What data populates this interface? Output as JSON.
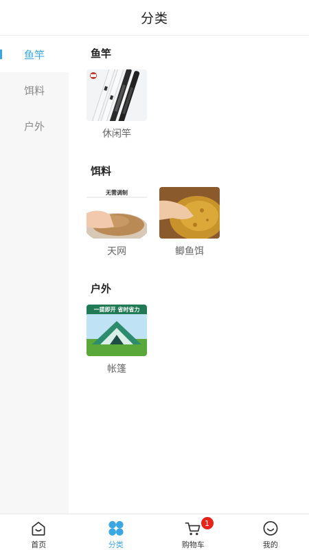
{
  "header": {
    "title": "分类"
  },
  "sidebar": {
    "items": [
      {
        "label": "鱼竿",
        "active": true
      },
      {
        "label": "饵料",
        "active": false
      },
      {
        "label": "户外",
        "active": false
      }
    ]
  },
  "groups": [
    {
      "title": "鱼竿",
      "products": [
        {
          "name": "休闲竿",
          "image": "fishing-rod-photo"
        }
      ]
    },
    {
      "title": "饵料",
      "products": [
        {
          "name": "天网",
          "image": "bait-in-bowl-photo",
          "image_text": "无需调制"
        },
        {
          "name": "鲫鱼饵",
          "image": "yellow-bait-photo"
        }
      ]
    },
    {
      "title": "户外",
      "products": [
        {
          "name": "帐篷",
          "image": "tent-photo",
          "image_text": "一提即开 省时省力"
        }
      ]
    }
  ],
  "tabbar": {
    "tabs": [
      {
        "label": "首页",
        "icon": "home-icon"
      },
      {
        "label": "分类",
        "icon": "category-icon",
        "active": true
      },
      {
        "label": "购物车",
        "icon": "cart-icon",
        "badge": "1"
      },
      {
        "label": "我的",
        "icon": "profile-icon"
      }
    ]
  },
  "colors": {
    "accent": "#3aa7e3",
    "badge": "#e8231c"
  }
}
